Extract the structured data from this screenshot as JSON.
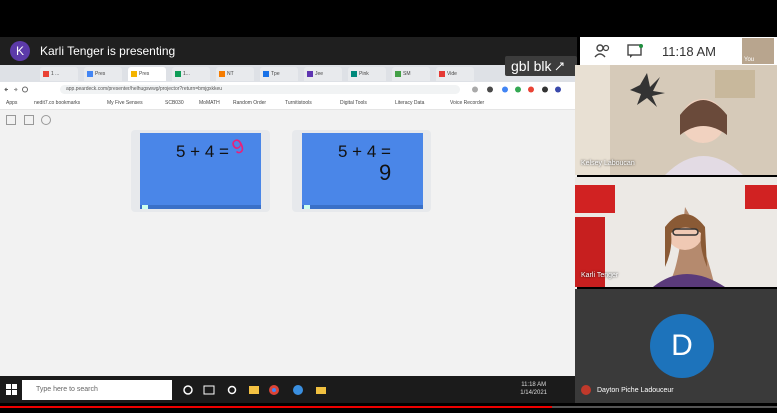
{
  "presenter": {
    "avatar_letter": "K",
    "text": "Karli Tenger is presenting"
  },
  "meet_top": {
    "time": "11:18 AM",
    "self_label": "You"
  },
  "browser": {
    "tabs": [
      "1 ...",
      "Pres",
      "Pres",
      "1...",
      "NT",
      "Tpe",
      "Jee",
      "Pink",
      "SM",
      "Vide"
    ],
    "url": "app.peardeck.com/presenter/helhugswwg/projector?return=bmjgxkkeu",
    "bookmarks": [
      "Apps",
      "nedit7.co bookmarks",
      "My Five Senses",
      "SCB030",
      "MoMATH",
      "Random Order",
      "Turnitistools",
      "Digital Tools",
      "Literacy Data",
      "Voice Recorder"
    ]
  },
  "slides": [
    {
      "equation": "5 + 4 =",
      "answer": "9"
    },
    {
      "equation": "5 + 4 =",
      "answer": "9"
    }
  ],
  "gbl_badge": "gbl blk",
  "taskbar": {
    "search_placeholder": "Type here to search",
    "time": "11:18 AM",
    "date": "1/14/2021"
  },
  "participants": [
    {
      "name": "Kelsey Laboucan"
    },
    {
      "name": "Karli Tenger"
    },
    {
      "name": "Dayton Piche Ladouceur",
      "avatar_letter": "D"
    }
  ],
  "video_progress": 0.71,
  "colors": {
    "slide_bg": "#4a86e8",
    "avatar_blue": "#1d73bb",
    "presenter_avatar": "#5c3aa9",
    "progress": "#ee0000"
  }
}
